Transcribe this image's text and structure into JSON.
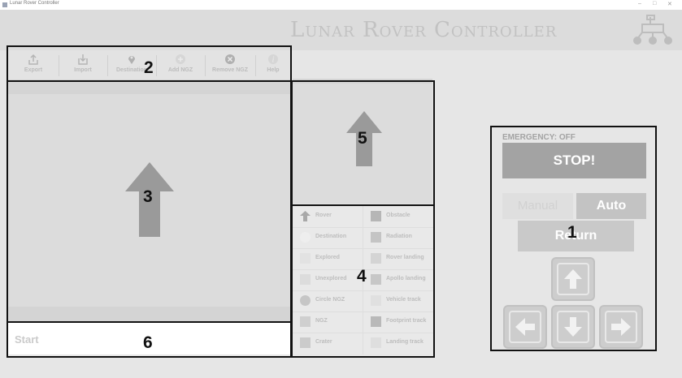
{
  "window": {
    "title": "Lunar Rover Controller"
  },
  "header": {
    "app_title": "Lunar Rover Controller"
  },
  "toolbar": {
    "buttons": [
      {
        "label": "Export",
        "icon": "export-icon"
      },
      {
        "label": "Import",
        "icon": "import-icon"
      },
      {
        "label": "Destination",
        "icon": "map-pin-icon"
      },
      {
        "label": "Add NGZ",
        "icon": "add-circle-icon"
      },
      {
        "label": "Remove NGZ",
        "icon": "remove-circle-icon"
      },
      {
        "label": "Help",
        "icon": "help-icon"
      }
    ]
  },
  "legend": {
    "left": [
      {
        "label": "Rover",
        "icon": "arrow-up-icon",
        "color": "#a8a8a8"
      },
      {
        "label": "Destination",
        "icon": "circle-icon",
        "color": "#eeeeee"
      },
      {
        "label": "Explored",
        "icon": "square-icon",
        "color": "#e2e2e2"
      },
      {
        "label": "Unexplored",
        "icon": "square-icon",
        "color": "#dcdcdc"
      },
      {
        "label": "Circle NGZ",
        "icon": "circle-icon",
        "color": "#c6c6c6"
      },
      {
        "label": "NGZ",
        "icon": "square-icon",
        "color": "#cfcfcf"
      },
      {
        "label": "Crater",
        "icon": "square-icon",
        "color": "#cbcbcb"
      }
    ],
    "right": [
      {
        "label": "Obstacle",
        "icon": "square-icon",
        "color": "#b6b6b6"
      },
      {
        "label": "Radiation",
        "icon": "square-icon",
        "color": "#c4c4c4"
      },
      {
        "label": "Rover landing",
        "icon": "square-icon",
        "color": "#d4d4d4"
      },
      {
        "label": "Apollo landing",
        "icon": "square-icon",
        "color": "#c7c7c7"
      },
      {
        "label": "Vehicle track",
        "icon": "square-icon",
        "color": "#e0e0e0"
      },
      {
        "label": "Footprint track",
        "icon": "square-icon",
        "color": "#b9b9b9"
      },
      {
        "label": "Landing track",
        "icon": "square-icon",
        "color": "#dedede"
      }
    ]
  },
  "status": {
    "text": "Start"
  },
  "controls": {
    "emergency_label": "EMERGENCY: OFF",
    "stop_label": "STOP!",
    "manual_label": "Manual",
    "auto_label": "Auto",
    "return_label": "Return",
    "arrow_icons": [
      "arrow-up-icon",
      "arrow-left-icon",
      "arrow-down-icon",
      "arrow-right-icon"
    ]
  },
  "annotations": [
    "1",
    "2",
    "3",
    "4",
    "5",
    "6"
  ],
  "colors": {
    "background": "#e6e6e6",
    "annotation_border": "#111111",
    "stop_button": "#a3a3a3",
    "map_arrow": "#9a9a9a"
  }
}
